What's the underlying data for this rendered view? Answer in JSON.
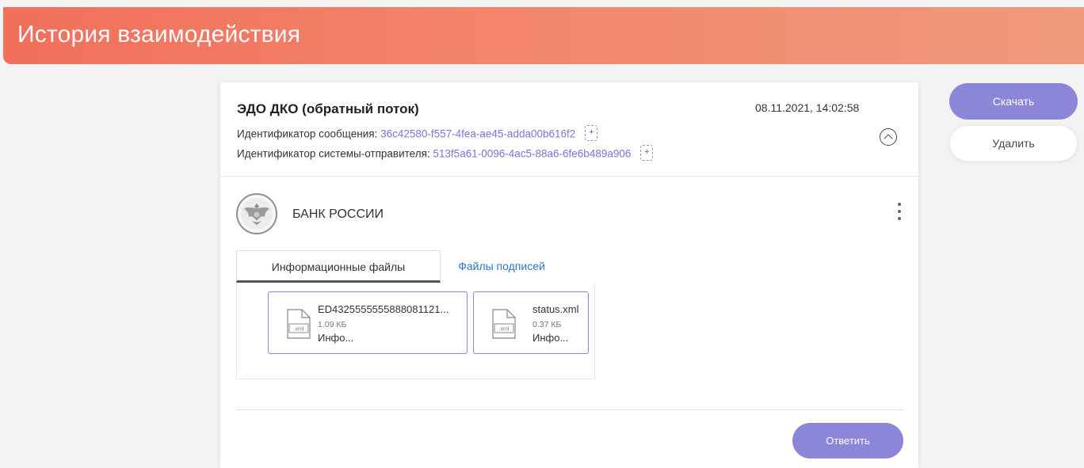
{
  "header": {
    "title": "История взаимодействия"
  },
  "message": {
    "title": "ЭДО ДКО (обратный поток)",
    "date": "08.11.2021, 14:02:58",
    "message_id_label": "Идентификатор сообщения: ",
    "message_id": "36c42580-f557-4fea-ae45-adda00b616f2",
    "sender_id_label": "Идентификатор системы-отправителя: ",
    "sender_id": "513f5a61-0096-4ac5-88a6-6fe6b489a906"
  },
  "organization": {
    "name": "БАНК РОССИИ"
  },
  "tabs": [
    {
      "label": "Информационные файлы",
      "active": true
    },
    {
      "label": "Файлы подписей",
      "active": false
    }
  ],
  "files": [
    {
      "name": "ED4325555555888081121...",
      "size": "1.09 КБ",
      "type": "Инфо...",
      "ext": ".xml"
    },
    {
      "name": "status.xml",
      "size": "0.37 КБ",
      "type": "Инфо...",
      "ext": ".xml"
    }
  ],
  "actions": {
    "reply": "Ответить",
    "download": "Скачать",
    "delete": "Удалить"
  },
  "colors": {
    "accent": "#8c86d8",
    "header_start": "#f16f5b",
    "header_end": "#ef9a7a",
    "link": "#7b74d6",
    "tab_link": "#2f74c0"
  },
  "icons": {
    "copy": "copy-icon",
    "collapse": "chevron-up-circle-icon",
    "menu": "kebab-menu-icon",
    "file": "xml-file-icon",
    "avatar": "bank-of-russia-emblem"
  }
}
